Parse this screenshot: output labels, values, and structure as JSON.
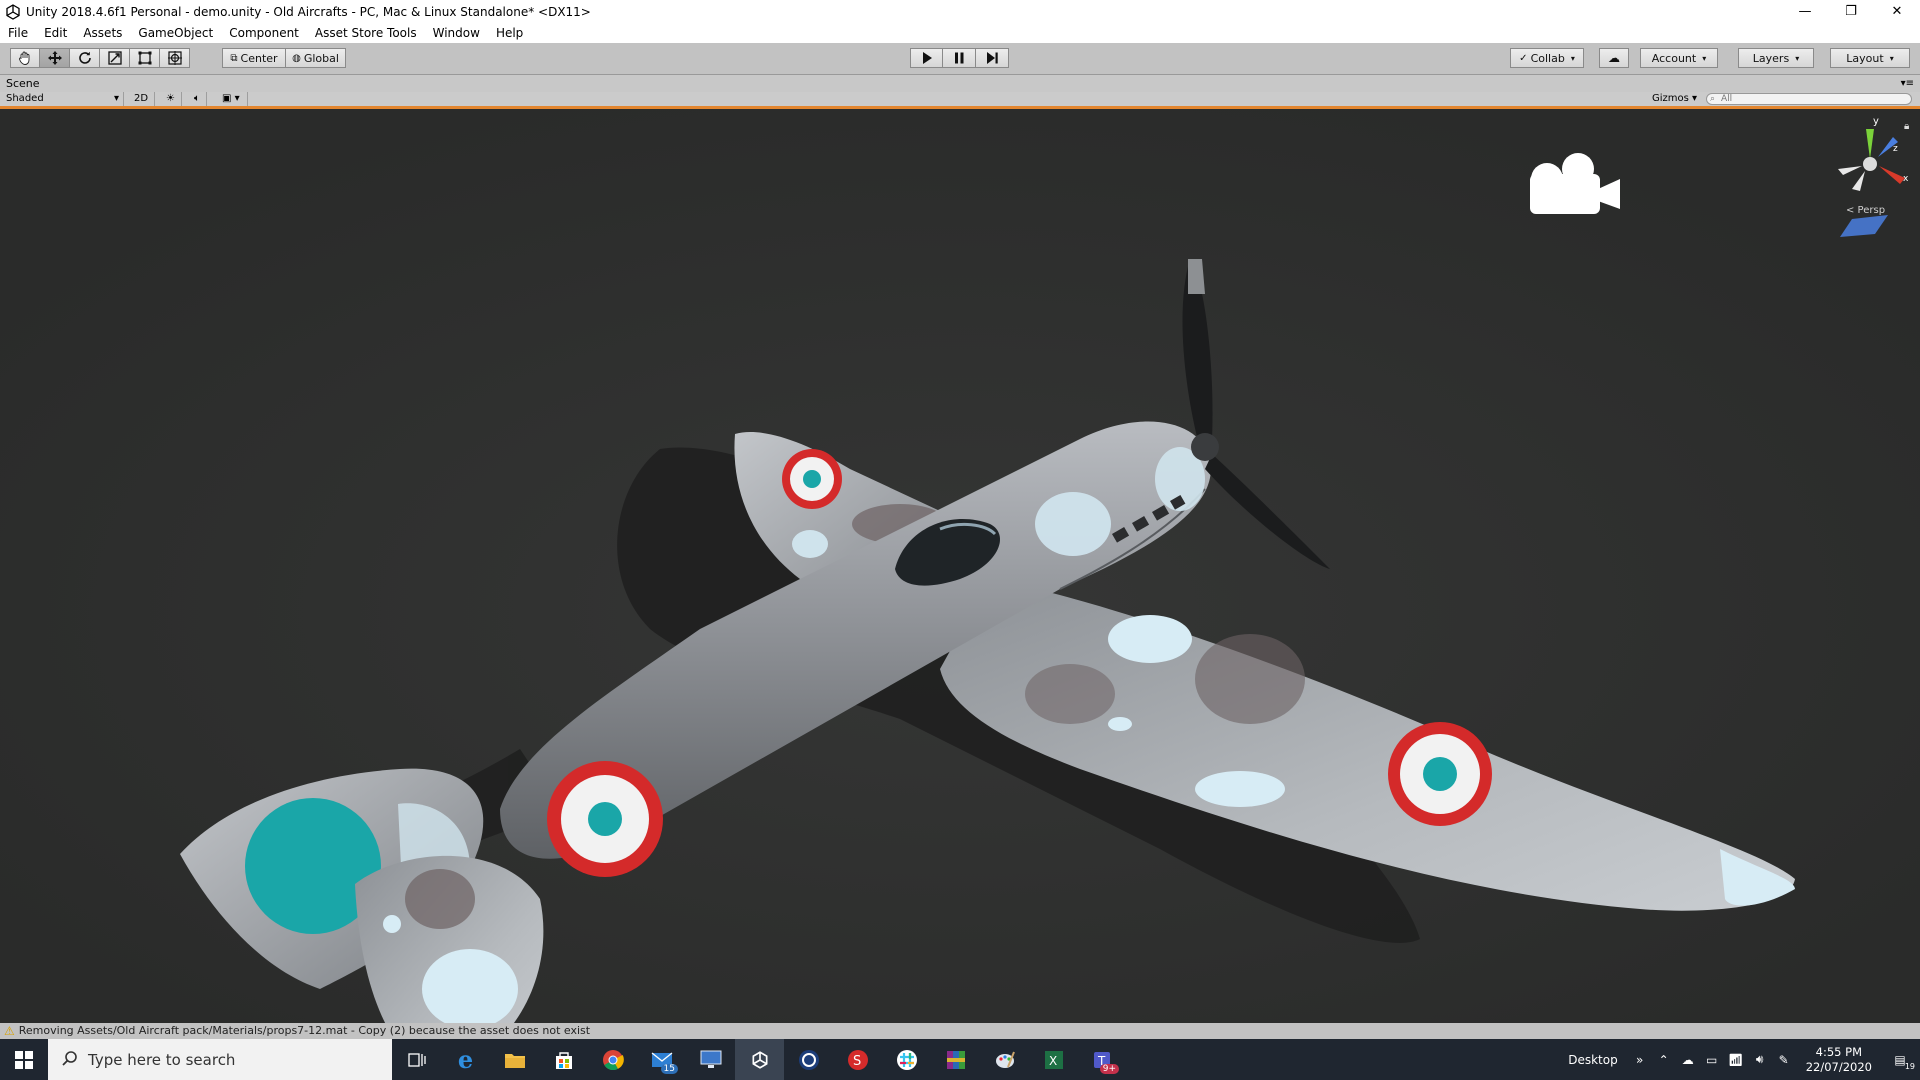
{
  "window": {
    "title": "Unity 2018.4.6f1 Personal - demo.unity - Old Aircrafts - PC, Mac & Linux Standalone* <DX11>",
    "minimize": "—",
    "restore": "❐",
    "close": "✕"
  },
  "menu": [
    "File",
    "Edit",
    "Assets",
    "GameObject",
    "Component",
    "Asset Store Tools",
    "Window",
    "Help"
  ],
  "toolbar": {
    "tools": [
      "hand-tool",
      "move-tool",
      "rotate-tool",
      "scale-tool",
      "rect-tool",
      "transform-tool"
    ],
    "pivot_mode": "Center",
    "pivot_rotation": "Global",
    "collab_label": "Collab",
    "account_label": "Account",
    "layers_label": "Layers",
    "layout_label": "Layout"
  },
  "scene": {
    "tab_label": "Scene",
    "shading_mode": "Shaded",
    "mode_2d": "2D",
    "gizmos_label": "Gizmos",
    "search_placeholder": "All",
    "projection_label": "< Persp",
    "axis_y": "y",
    "axis_z": "z",
    "axis_x": "x"
  },
  "console": {
    "message": "Removing Assets/Old Aircraft pack/Materials/props7-12.mat - Copy (2) because the asset does not exist"
  },
  "taskbar": {
    "search_placeholder": "Type here to search",
    "icons": [
      {
        "name": "task-view-icon"
      },
      {
        "name": "edge-icon"
      },
      {
        "name": "file-explorer-icon"
      },
      {
        "name": "store-icon"
      },
      {
        "name": "chrome-icon"
      },
      {
        "name": "mail-icon",
        "badge": "15"
      },
      {
        "name": "remote-desktop-icon"
      },
      {
        "name": "unity-icon",
        "active": true
      },
      {
        "name": "cinema4d-icon"
      },
      {
        "name": "substance-icon"
      },
      {
        "name": "slack-icon"
      },
      {
        "name": "winrar-icon"
      },
      {
        "name": "paint-icon"
      },
      {
        "name": "excel-icon"
      },
      {
        "name": "teams-icon",
        "badge": "9+"
      }
    ],
    "desktop_label": "Desktop",
    "time": "4:55 PM",
    "date": "22/07/2020",
    "notifications": "19"
  },
  "colors": {
    "accent_orange": "#e3862f",
    "viewport_bg": "#2f302f",
    "roundel_red": "#d42a2a",
    "roundel_teal": "#1aa6a8"
  }
}
